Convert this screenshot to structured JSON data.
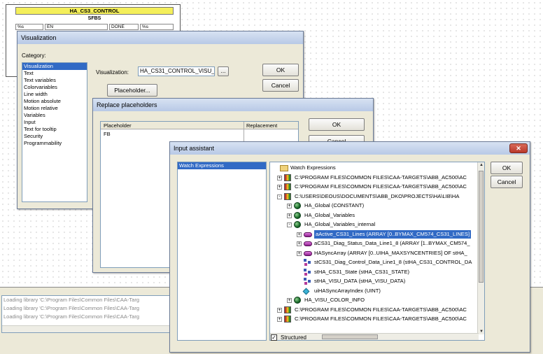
{
  "function_block": {
    "title": "HA_CS3_CONTROL",
    "subtitle": "SFBS",
    "cells": [
      "%s",
      "EN",
      "DONE",
      "%s"
    ]
  },
  "visualization_dialog": {
    "title": "Visualization",
    "category_label": "Category:",
    "categories": [
      "Visualization",
      "Text",
      "Text variables",
      "Colorvariables",
      "Line width",
      "Motion absolute",
      "Motion relative",
      "Variables",
      "Input",
      "Text for tooltip",
      "Security",
      "Programmability"
    ],
    "visualization_label": "Visualization:",
    "visualization_value": "HA_CS31_CONTROL_VISU_",
    "browse_label": "...",
    "placeholder_button": "Placeholder...",
    "ok_label": "OK",
    "cancel_label": "Cancel"
  },
  "replace_dialog": {
    "title": "Replace placeholders",
    "col_placeholder": "Placeholder",
    "col_replacement": "Replacement",
    "rows": [
      {
        "placeholder": "FB",
        "replacement": ""
      }
    ],
    "ok_label": "OK",
    "cancel_label": "Cancel"
  },
  "input_assistant": {
    "title": "Input assistant",
    "left_items": [
      "Watch Expressions"
    ],
    "tree": [
      {
        "text": "Watch Expressions",
        "icon": "folder-icon",
        "toggle": ""
      },
      {
        "text": "C:\\PROGRAM FILES\\COMMON FILES\\CAA-TARGETS\\ABB_AC500\\AC",
        "icon": "library-book-icon",
        "toggle": "+"
      },
      {
        "text": "C:\\PROGRAM FILES\\COMMON FILES\\CAA-TARGETS\\ABB_AC500\\AC",
        "icon": "library-book-icon",
        "toggle": "+"
      },
      {
        "text": "C:\\USERS\\DEOUS\\DOCUMENTS\\ABB_DKO\\PROJECTS\\HA\\LIB\\HA",
        "icon": "library-book-icon",
        "toggle": "-"
      },
      {
        "text": "HA_Global (CONSTANT)",
        "icon": "globe-icon",
        "toggle": "+"
      },
      {
        "text": "HA_Global_Variables",
        "icon": "globe-icon",
        "toggle": "+"
      },
      {
        "text": "HA_Global_Variables_internal",
        "icon": "globe-icon",
        "toggle": "-"
      },
      {
        "text": "aActive_CS31_Lines (ARRAY [0..BYMAX_CM574_CS31_LINES]",
        "icon": "array-icon",
        "toggle": "+",
        "selected": true
      },
      {
        "text": "aCS31_Diag_Status_Data_Line1_8 (ARRAY [1..BYMAX_CM574_",
        "icon": "array-icon",
        "toggle": "+"
      },
      {
        "text": "HASyncArray (ARRAY [0..UIHA_MAXSYNCENTRIES] OF stHA_",
        "icon": "array-icon",
        "toggle": "+"
      },
      {
        "text": "stCS31_Diag_Control_Data_Line1_8 (stHA_CS31_CONTROL_DA",
        "icon": "struct-icon",
        "toggle": ""
      },
      {
        "text": "stHA_CS31_State (stHA_CS31_STATE)",
        "icon": "struct-icon",
        "toggle": ""
      },
      {
        "text": "stHA_VISU_DATA (stHA_VISU_DATA)",
        "icon": "struct-icon",
        "toggle": ""
      },
      {
        "text": "uiHASyncArrayIndex (UINT)",
        "icon": "uint-diamond-icon",
        "toggle": ""
      },
      {
        "text": "HA_VISU_COLOR_INFO",
        "icon": "globe-icon",
        "toggle": "+"
      },
      {
        "text": "C:\\PROGRAM FILES\\COMMON FILES\\CAA-TARGETS\\ABB_AC500\\AC",
        "icon": "library-book-icon",
        "toggle": "+"
      },
      {
        "text": "C:\\PROGRAM FILES\\COMMON FILES\\CAA-TARGETS\\ABB_AC500\\AC",
        "icon": "library-book-icon",
        "toggle": "+"
      }
    ],
    "structured_label": "Structured",
    "structured_checked": true,
    "ok_label": "OK",
    "cancel_label": "Cancel"
  },
  "message_log": [
    "Loading library 'C:\\Program Files\\Common Files\\CAA-Targ",
    "Loading library 'C:\\Program Files\\Common Files\\CAA-Targ",
    "Loading library 'C:\\Program Files\\Common Files\\CAA-Targ"
  ]
}
